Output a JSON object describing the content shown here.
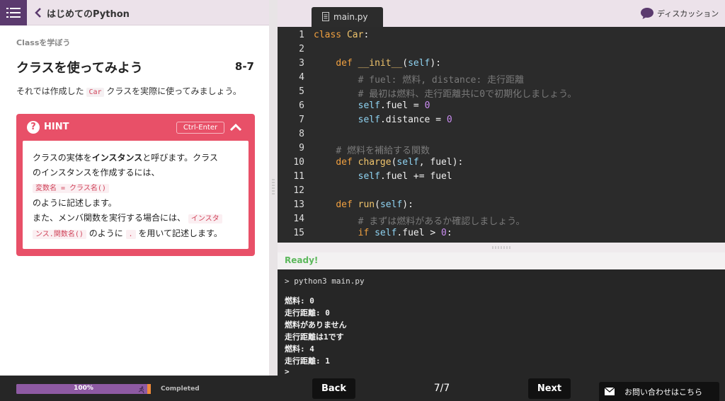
{
  "header": {
    "menu_icon": "hamburger-menu-icon",
    "back_icon": "chevron-left-icon",
    "course_title": "はじめてのPython"
  },
  "lesson": {
    "section": "Classを学ぼう",
    "title": "クラスを使ってみよう",
    "number": "8-7",
    "desc_before": "それでは作成した",
    "desc_code": "Car",
    "desc_after": "クラスを実際に使ってみましょう。"
  },
  "hint": {
    "label": "HINT",
    "shortcut": "Ctrl-Enter",
    "line1_a": "クラスの実体を",
    "line1_b": "インスタンス",
    "line1_c": "と呼びます。クラス",
    "line2": "のインスタンスを作成するには、",
    "code1": "変数名 = クラス名()",
    "line3": "のように記述します。",
    "line4_a": "また、メンバ関数を実行する場合には、",
    "code2a": "インスタ",
    "code2b": "ンス.関数名()",
    "line5_a": "のように",
    "code3": ".",
    "line5_b": "を用いて記述します。",
    "color": "#e85068"
  },
  "editor": {
    "tab_label": "main.py",
    "discussion_label": "ディスカッション",
    "line_numbers": [
      "1",
      "2",
      "3",
      "4",
      "5",
      "6",
      "7",
      "8",
      "9",
      "10",
      "11",
      "12",
      "13",
      "14",
      "15"
    ],
    "code": {
      "l1_kw": "class",
      "l1_name": "Car",
      "l1_end": ":",
      "l3_kw": "def",
      "l3_fn": "__init__",
      "l3_open": "(",
      "l3_self": "self",
      "l3_end": "):",
      "l4": "# fuel: 燃料, distance: 走行距離",
      "l5": "# 最初は燃料、走行距離共に0で初期化しましょう。",
      "l6_self": "self",
      "l6_rest": ".fuel = ",
      "l6_num": "0",
      "l7_self": "self",
      "l7_rest": ".distance = ",
      "l7_num": "0",
      "l9": "# 燃料を補給する関数",
      "l10_kw": "def",
      "l10_fn": "charge",
      "l10_open": "(",
      "l10_self": "self",
      "l10_rest": ", fuel):",
      "l11_self": "self",
      "l11_rest": ".fuel += fuel",
      "l13_kw": "def",
      "l13_fn": "run",
      "l13_open": "(",
      "l13_self": "self",
      "l13_end": "):",
      "l14": "# まずは燃料があるか確認しましょう。",
      "l15_kw": "if",
      "l15_self": "self",
      "l15_rest": ".fuel > ",
      "l15_num": "0",
      "l15_end": ":"
    }
  },
  "console": {
    "status": "Ready!",
    "command": "> python3 main.py",
    "output": [
      "燃料: 0",
      "走行距離: 0",
      "燃料がありません",
      "走行距離は1です",
      "燃料: 4",
      "走行距離: 1",
      ">"
    ]
  },
  "footer": {
    "progress_percent": 100,
    "progress_label": "100%",
    "completed_label": "Completed",
    "back_label": "Back",
    "page_indicator": "7/7",
    "next_label": "Next",
    "contact_label": "お問い合わせはこちら"
  }
}
